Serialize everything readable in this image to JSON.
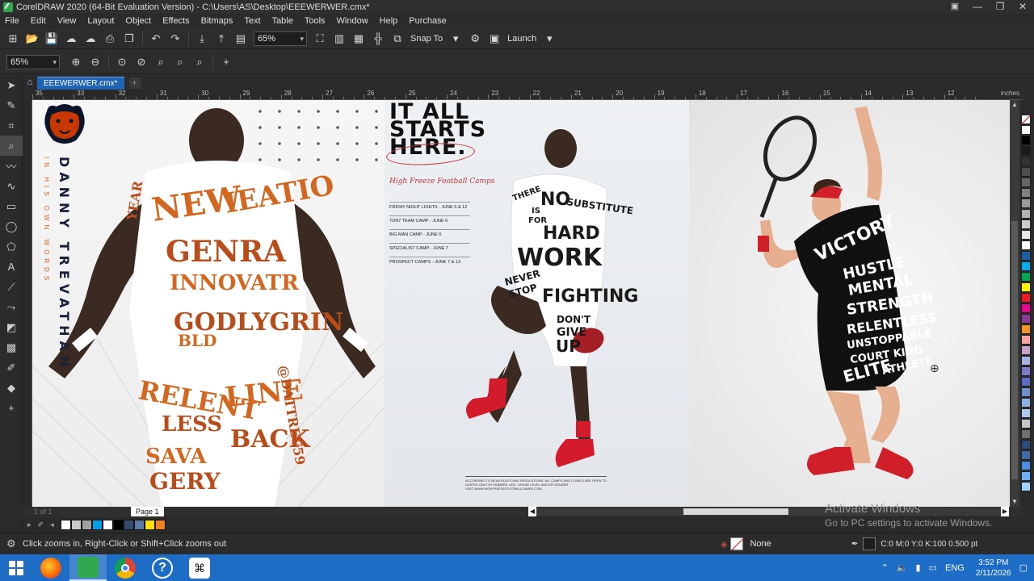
{
  "window": {
    "title": "CorelDRAW 2020 (64-Bit Evaluation Version) - C:\\Users\\AS\\Desktop\\EEEWERWER.cmx*"
  },
  "menu": [
    "File",
    "Edit",
    "View",
    "Layout",
    "Object",
    "Effects",
    "Bitmaps",
    "Text",
    "Table",
    "Tools",
    "Window",
    "Help",
    "Purchase"
  ],
  "toolbar": {
    "zoom_value": "65%",
    "snap_to_label": "Snap To",
    "launch_label": "Launch"
  },
  "propbar": {
    "zoom_value": "65%"
  },
  "document": {
    "tab_label": "EEEWERWER.cmx*",
    "page_tab": "Page 1",
    "page_nav": "1 of 1",
    "ruler_units": "inches",
    "ruler_labels": [
      "35",
      "33",
      "32",
      "31",
      "30",
      "29",
      "28",
      "27",
      "26",
      "25",
      "24",
      "23",
      "22",
      "21",
      "20",
      "19",
      "18",
      "17",
      "16",
      "15",
      "14",
      "13",
      "12"
    ]
  },
  "poster1": {
    "name_vertical": "DANNY TREVATHAN",
    "sub_vertical": "IN HIS OWN WORDS",
    "words": [
      "NEW",
      "YEAR",
      "IEATIO",
      "GENRA",
      "INNOVATR",
      "GODLYGRIN",
      "BLD",
      "RELENTLESS",
      "LINE",
      "BACKER",
      "SAVAGERY",
      "@DATTREV59"
    ]
  },
  "poster2": {
    "headline": [
      "IT ALL",
      "STARTS",
      "HERE."
    ],
    "camp_title": "High Freeze Football Camps",
    "events": [
      "FRIDAY NIGHT LIGHTS - JUNE 5 & 12",
      "7ON7 TEAM CAMP - JUNE 6",
      "BIG MAN CAMP - JUNE 6",
      "SPECIALIST CAMP - JUNE 7",
      "PROSPECT CAMPS - JUNE 7 & 13"
    ],
    "body_words": [
      "THERE",
      "IS",
      "NO",
      "SUBSTITUTE",
      "FOR",
      "HARD",
      "WORK",
      "NEVER",
      "STOP",
      "FIGHTING",
      "DON'T",
      "GIVE",
      "UP"
    ],
    "fine_print": [
      "ACCORDING TO NCAA RULES AND REGULATIONS, ALL CAMPS AND CLINICS ARE OPEN TO ANY AND ALL ENTRANTS",
      "LIMITED ONLY BY NUMBER, AGE, GRADE LEVEL AND/OR GENDER",
      "VISIT WWW.HIGHFREEZEFOOTBALLCAMPS.COM"
    ]
  },
  "poster3": {
    "body_words": [
      "VICTORY",
      "HUSTLE",
      "MENTAL",
      "STRENGTH",
      "RELENTLESS",
      "UNSTOPPABLE",
      "COURT KING",
      "ELITE",
      "ATHLETE"
    ]
  },
  "watermark": {
    "line1": "Activate Windows",
    "line2": "Go to PC settings to activate Windows."
  },
  "status": {
    "hint": "Click zooms in, Right-Click or Shift+Click zooms out",
    "fill_label": "None",
    "outline_label": "C:0 M:0 Y:0 K:100  0.500 pt"
  },
  "taskbar": {
    "language": "ENG",
    "time": "3:52 PM",
    "date": "2/11/2026"
  },
  "colors": {
    "accent": "#1f63b5",
    "taskbar": "#1d6cc5",
    "poster_orange": "#d4671f",
    "poster_red": "#c0303a"
  },
  "palette_colors": [
    "#ffffff",
    "#000000",
    "#1a1a1a",
    "#333333",
    "#4d4d4d",
    "#666666",
    "#808080",
    "#999999",
    "#b3b3b3",
    "#cccccc",
    "#e6e6e6",
    "#ffffff",
    "#1f5fa8",
    "#00aeef",
    "#00a651",
    "#fff200",
    "#ed1c24",
    "#ec008c",
    "#8b3a98",
    "#f7941d",
    "#f9a3a3",
    "#c8a2c8",
    "#a8b4e0",
    "#7a7ac8",
    "#5c6bc0",
    "#6f8fd0",
    "#8db0e8",
    "#b0c8f0",
    "#c7c7c7",
    "#707070",
    "#2a4d7a",
    "#3f6aa8",
    "#4a90e2",
    "#6ab0ff",
    "#9fd0ff"
  ],
  "doc_palette_colors": [
    "#ffffff",
    "#c8c8c8",
    "#a0a0a0",
    "#00a0e9",
    "#ffffff",
    "#000000",
    "#3a4a6a",
    "#5a78a8",
    "#ffe000",
    "#f08020"
  ]
}
